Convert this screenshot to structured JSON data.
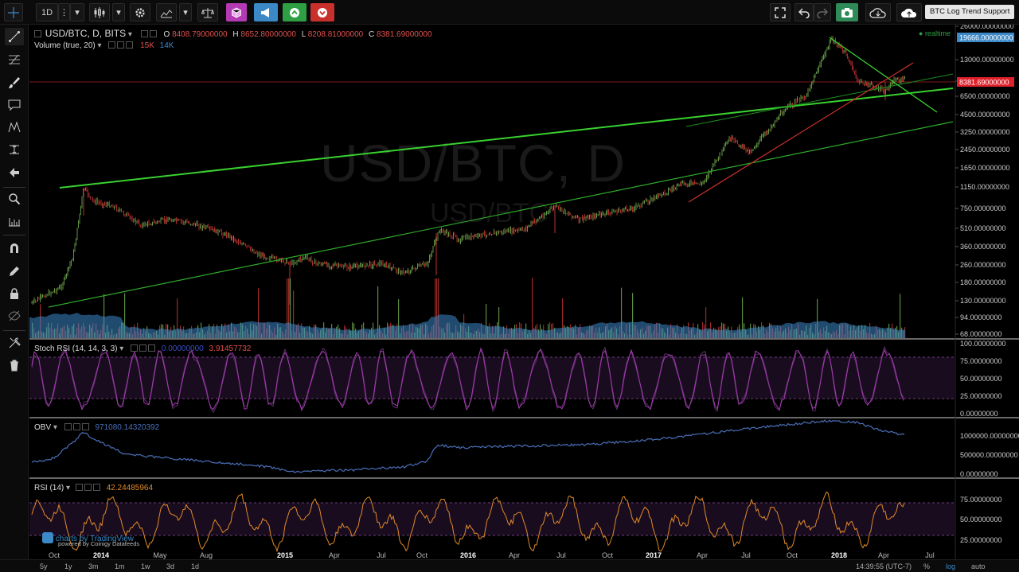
{
  "toolbar": {
    "interval": "1D",
    "tooltip": "BTC Log Trend Support"
  },
  "main_legend": {
    "title": "USD/BTC, D, BITS",
    "o_label": "O",
    "o_value": "8408.79000000",
    "h_label": "H",
    "h_value": "8652.80000000",
    "l_label": "L",
    "l_value": "8208.81000000",
    "c_label": "C",
    "c_value": "8381.69000000",
    "volume_title": "Volume (true, 20)",
    "volume_v1": "15K",
    "volume_v2": "14K",
    "realtime": "realtime"
  },
  "watermark": {
    "big": "USD/BTC, D",
    "small": "USD/BTC"
  },
  "price_axis": {
    "ticks": [
      "26000.00000000",
      "13000.00000000",
      "8500.00000000",
      "6500.00000000",
      "4500.00000000",
      "3250.00000000",
      "2450.00000000",
      "1650.00000000",
      "1150.00000000",
      "750.00000000",
      "510.00000000",
      "360.00000000",
      "260.00000000",
      "180.00000000",
      "130.00000000",
      "94.00000000",
      "68.00000000"
    ],
    "top_label": "19666.00000000",
    "last_label": "8381.69000000"
  },
  "stoch": {
    "title": "Stoch RSI (14, 14, 3, 3)",
    "k_value": "0.00000000",
    "d_value": "3.91457732",
    "ticks": [
      "100.00000000",
      "75.00000000",
      "50.00000000",
      "25.00000000",
      "0.00000000"
    ]
  },
  "obv": {
    "title": "OBV",
    "value": "971080.14320392",
    "ticks": [
      "1000000.00000000",
      "500000.00000000",
      "0.00000000"
    ]
  },
  "rsi": {
    "title": "RSI (14)",
    "value": "42.24485964",
    "ticks": [
      "75.00000000",
      "50.00000000",
      "25.00000000"
    ]
  },
  "time_axis": [
    "Oct",
    "2014",
    "May",
    "Aug",
    "2015",
    "Apr",
    "Jul",
    "Oct",
    "2016",
    "Apr",
    "Jul",
    "Oct",
    "2017",
    "Apr",
    "Jul",
    "Oct",
    "2018",
    "Apr",
    "Jul"
  ],
  "branding": {
    "line1": "charts by TradingView",
    "line2": "powered by Coinigy Datafeeds"
  },
  "bottom": {
    "ranges": [
      "5y",
      "1y",
      "3m",
      "1m",
      "1w",
      "3d",
      "1d"
    ],
    "clock": "14:39:55 (UTC-7)",
    "percent": "%",
    "log": "log",
    "auto": "auto"
  },
  "colors": {
    "up": "#6ba54b",
    "down": "#b8322f",
    "accent": "#3c89c8",
    "stoch": "#a33bb0",
    "obv": "#4a6fb8",
    "rsi": "#e08a28",
    "trend_green": "#39d12f",
    "trend_red": "#c8302b"
  },
  "icons": [
    "crosshair-icon",
    "settings-icon",
    "indicators-icon",
    "compare-icon",
    "alert-icon",
    "fullscreen-icon",
    "undo-icon",
    "redo-icon",
    "camera-icon",
    "cloud-icon"
  ]
}
